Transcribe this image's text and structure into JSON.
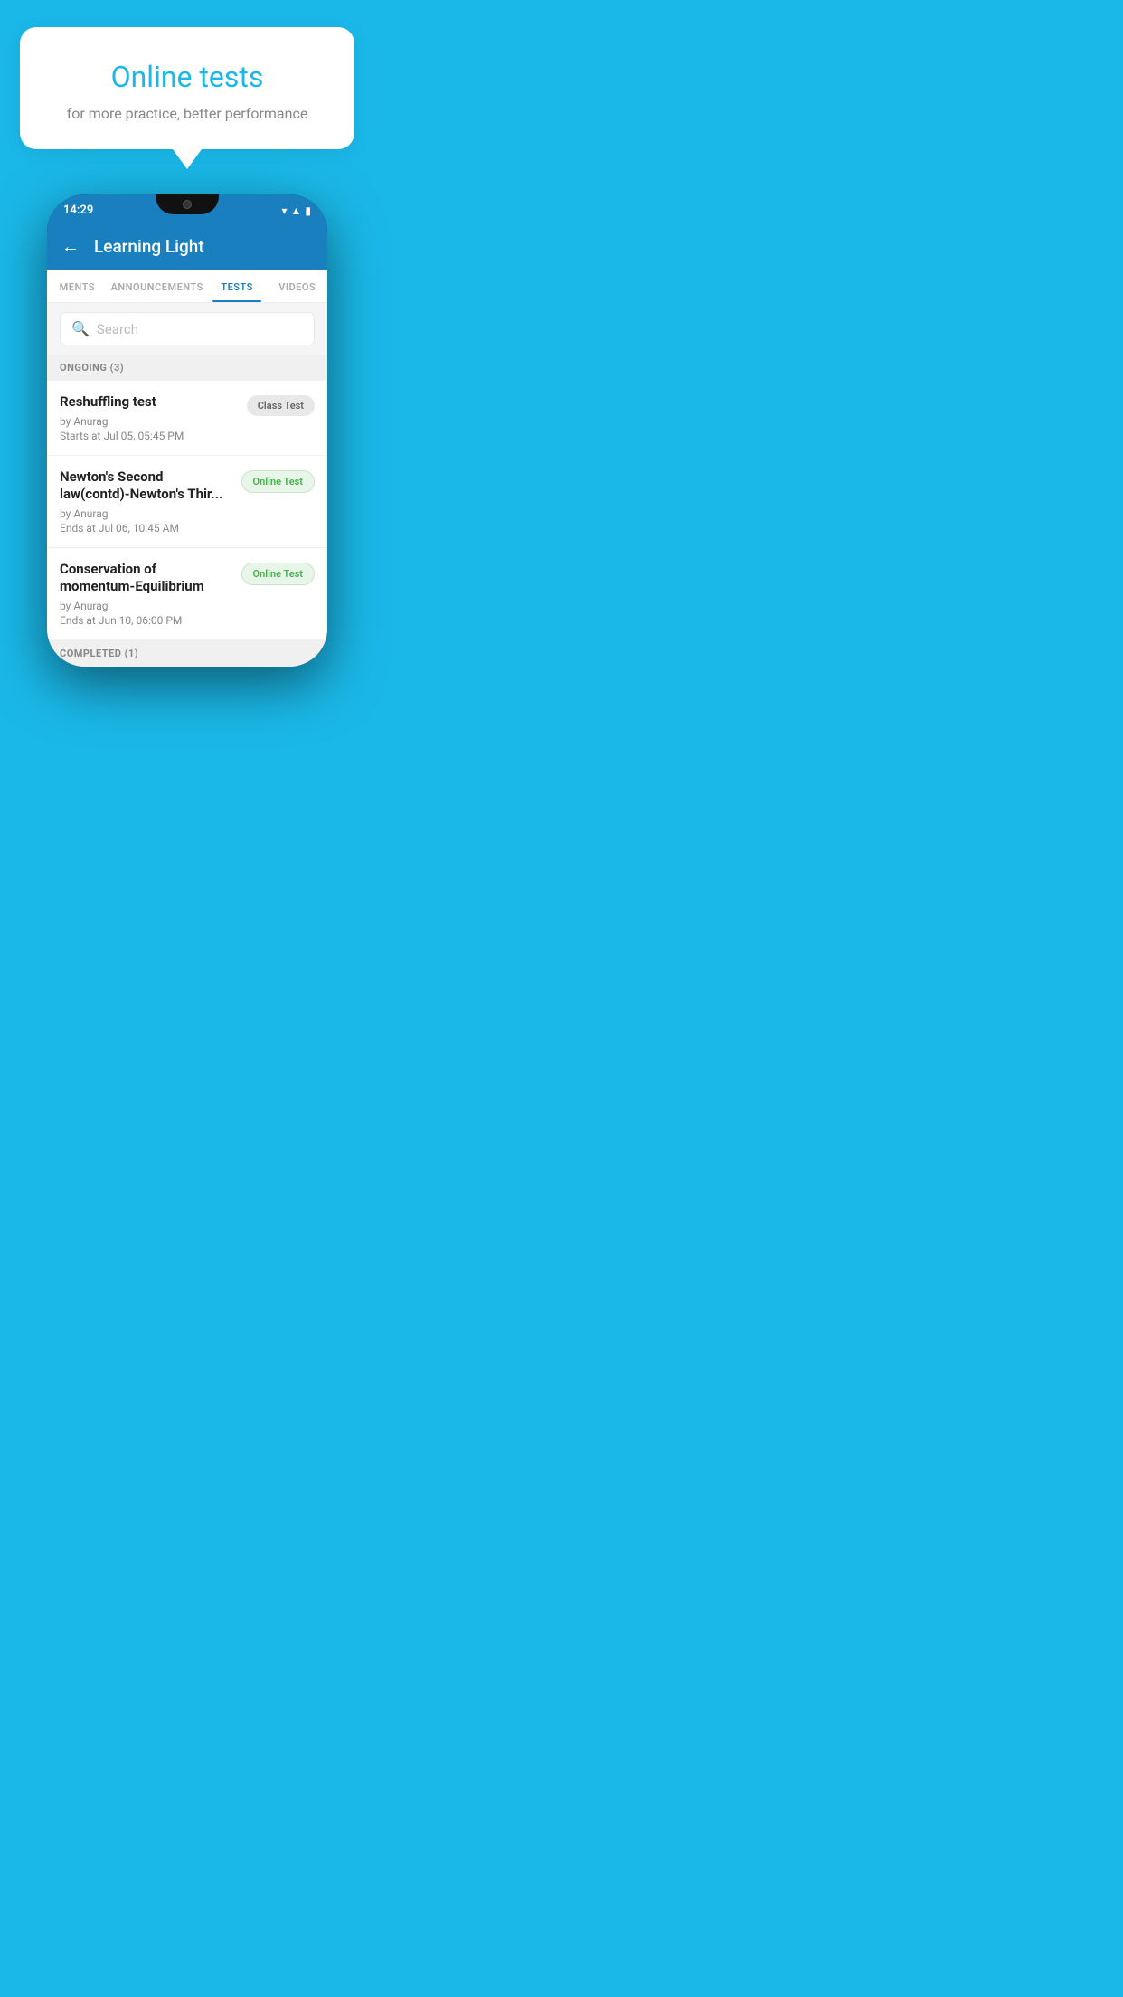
{
  "background_color": "#1ab8e8",
  "speech_bubble": {
    "title": "Online tests",
    "subtitle": "for more practice, better performance"
  },
  "phone": {
    "status_bar": {
      "time": "14:29",
      "icons": [
        "wifi",
        "signal",
        "battery"
      ]
    },
    "header": {
      "title": "Learning Light",
      "back_label": "←"
    },
    "tabs": [
      {
        "label": "MENTS",
        "active": false
      },
      {
        "label": "ANNOUNCEMENTS",
        "active": false
      },
      {
        "label": "TESTS",
        "active": true
      },
      {
        "label": "VIDEOS",
        "active": false
      }
    ],
    "search": {
      "placeholder": "Search"
    },
    "ongoing_section": {
      "label": "ONGOING (3)"
    },
    "tests": [
      {
        "name": "Reshuffling test",
        "by": "by Anurag",
        "date_label": "Starts at",
        "date": "Jul 05, 05:45 PM",
        "badge": "Class Test",
        "badge_type": "class"
      },
      {
        "name": "Newton's Second law(contd)-Newton's Thir...",
        "by": "by Anurag",
        "date_label": "Ends at",
        "date": "Jul 06, 10:45 AM",
        "badge": "Online Test",
        "badge_type": "online"
      },
      {
        "name": "Conservation of momentum-Equilibrium",
        "by": "by Anurag",
        "date_label": "Ends at",
        "date": "Jun 10, 06:00 PM",
        "badge": "Online Test",
        "badge_type": "online"
      }
    ],
    "completed_section": {
      "label": "COMPLETED (1)"
    }
  }
}
